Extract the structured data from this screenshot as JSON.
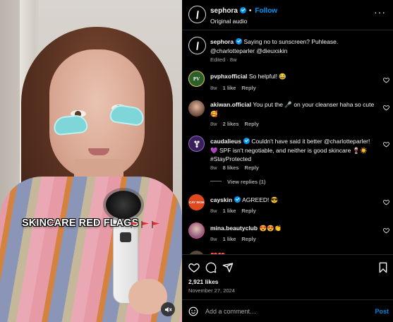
{
  "header": {
    "username": "sephora",
    "follow_label": "Follow",
    "audio_label": "Original audio",
    "separator": "•"
  },
  "video": {
    "overlay_text": "SKINCARE RED FLAGS"
  },
  "caption": {
    "username": "sephora",
    "line1": "Saying no to sunscreen? Puhlease.",
    "line2": "@charlotteparler @dieuxskin",
    "meta": "Edited · 8w"
  },
  "comments": [
    {
      "username": "pvphxofficial",
      "verified": false,
      "text": "So helpful! 😂",
      "time": "8w",
      "likes": "1 like",
      "reply": "Reply",
      "avatar_text": "PV",
      "avatar_color": "#2b5f2b"
    },
    {
      "username": "akiwan.official",
      "verified": false,
      "text": "You put the 🎤 on your cleanser haha so cute",
      "text2": "🥰",
      "time": "8w",
      "likes": "2 likes",
      "reply": "Reply",
      "avatar_color": "#6b4a3a"
    },
    {
      "username": "caudalieus",
      "verified": true,
      "text": "Couldn't have said it better @charlotteparler!",
      "text2": "💜 SPF isn't negotiable, and neither is good skincare 🍷☀️",
      "text3": "#StayProtected",
      "time": "8w",
      "likes": "8 likes",
      "reply": "Reply",
      "view_replies": "View replies (1)",
      "avatar_color": "#3a1f5c"
    },
    {
      "username": "cayskin",
      "verified": true,
      "text": "AGREED! 😎",
      "time": "8w",
      "likes": "1 like",
      "reply": "Reply",
      "avatar_text": "CAY SKIN",
      "avatar_color": "#e0491f"
    },
    {
      "username": "mina.beautyclub",
      "verified": false,
      "text": "😍😍👏",
      "time": "8w",
      "likes": "1 like",
      "reply": "Reply",
      "avatar_color": "#8a5a7a"
    },
    {
      "username": "",
      "verified": false,
      "text": "❤️❤️",
      "avatar_color": "#5a4a3a"
    }
  ],
  "actions": {
    "likes": "2,921 likes",
    "date": "November 27, 2024"
  },
  "composer": {
    "placeholder": "Add a comment…",
    "post_label": "Post"
  }
}
